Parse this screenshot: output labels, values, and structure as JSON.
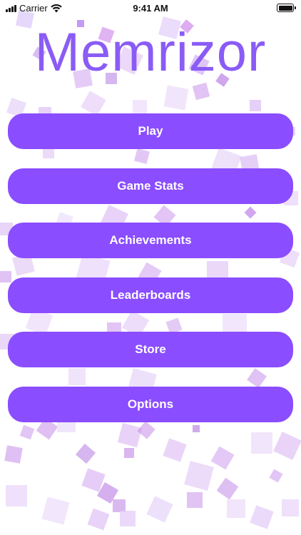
{
  "status_bar": {
    "carrier": "Carrier",
    "time": "9:41 AM",
    "wifi_icon": "wifi-icon",
    "battery_icon": "battery-icon"
  },
  "app": {
    "title": "Memrizor",
    "accent_color": "#8a4dff",
    "title_color": "#8a5cf6"
  },
  "menu": {
    "items": [
      {
        "label": "Play"
      },
      {
        "label": "Game Stats"
      },
      {
        "label": "Achievements"
      },
      {
        "label": "Leaderboards"
      },
      {
        "label": "Store"
      },
      {
        "label": "Options"
      }
    ]
  }
}
